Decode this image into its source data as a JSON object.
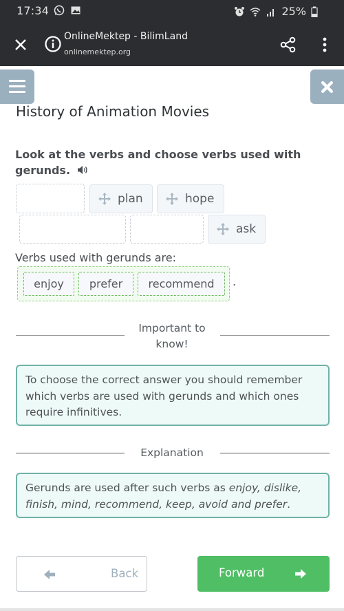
{
  "statusbar": {
    "time": "17:34",
    "left_icons": [
      "whatsapp-icon",
      "image-icon"
    ],
    "right_icons": [
      "alarm-icon",
      "wifi-icon",
      "signal-icon",
      "battery-icon"
    ],
    "battery": "25%"
  },
  "browser": {
    "title": "OnlineMektep - BilimLand",
    "url": "onlinemektep.org"
  },
  "page": {
    "title": "History of Animation Movies",
    "question": "Look at the verbs and choose verbs used with gerunds.",
    "source_chips": [
      "plan",
      "hope",
      "ask"
    ],
    "answer_label": "Verbs used with gerunds are:",
    "answer_chips": [
      "enjoy",
      "prefer",
      "recommend"
    ],
    "answer_suffix": ".",
    "important": {
      "heading": "Important to know!",
      "text": "To choose the correct answer you should remember which verbs are used with gerunds and which ones require infinitives."
    },
    "explanation": {
      "heading": "Explanation",
      "text_plain": "Gerunds are used after such verbs as ",
      "text_italic": "enjoy, dislike, finish, mind, recommend, keep, avoid and prefer",
      "text_end": "."
    }
  },
  "nav": {
    "back_label": "Back",
    "forward_label": "Forward"
  },
  "colors": {
    "accent_green": "#4fbe64",
    "sidebar_button": "#9bb0bf",
    "note_border": "#6fb3a7",
    "toolbar_bg": "#2c2d31"
  }
}
